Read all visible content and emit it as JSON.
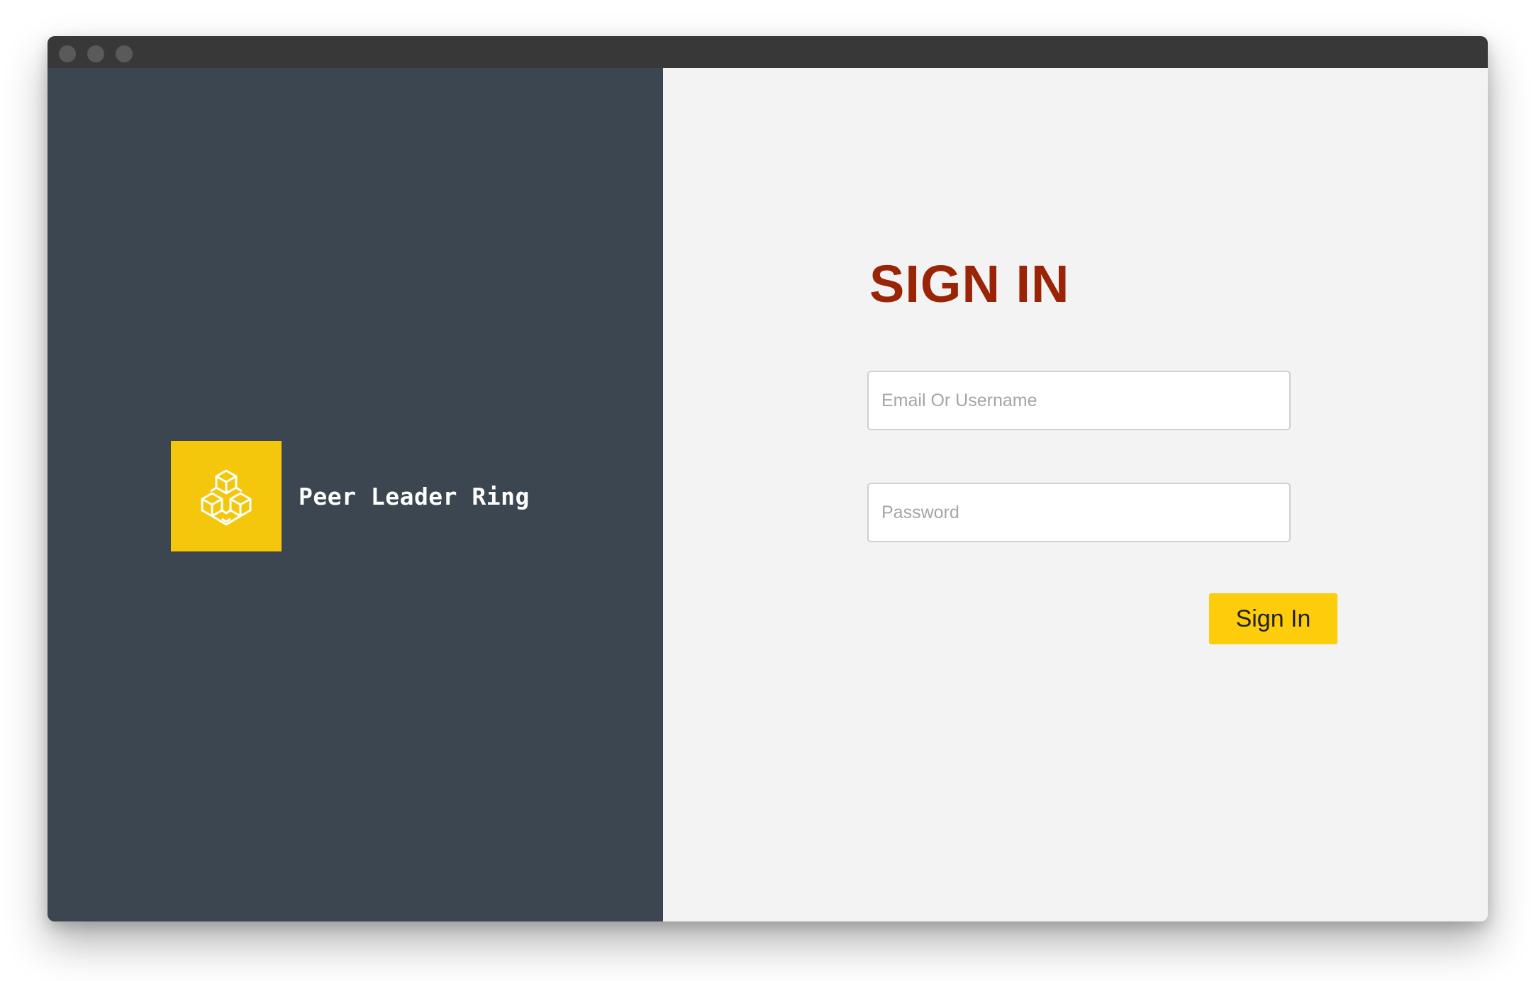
{
  "window": {
    "controls": [
      "close",
      "minimize",
      "maximize"
    ]
  },
  "brand": {
    "name": "Peer Leader Ring",
    "logo_icon": "cubes-icon",
    "logo_color": "#f5c70c",
    "panel_color": "#3b4650"
  },
  "signin": {
    "title": "SIGN IN",
    "title_color": "#9a2406",
    "email_placeholder": "Email Or Username",
    "email_value": "",
    "password_placeholder": "Password",
    "password_value": "",
    "button_label": "Sign In",
    "button_color": "#fdcc0a"
  }
}
